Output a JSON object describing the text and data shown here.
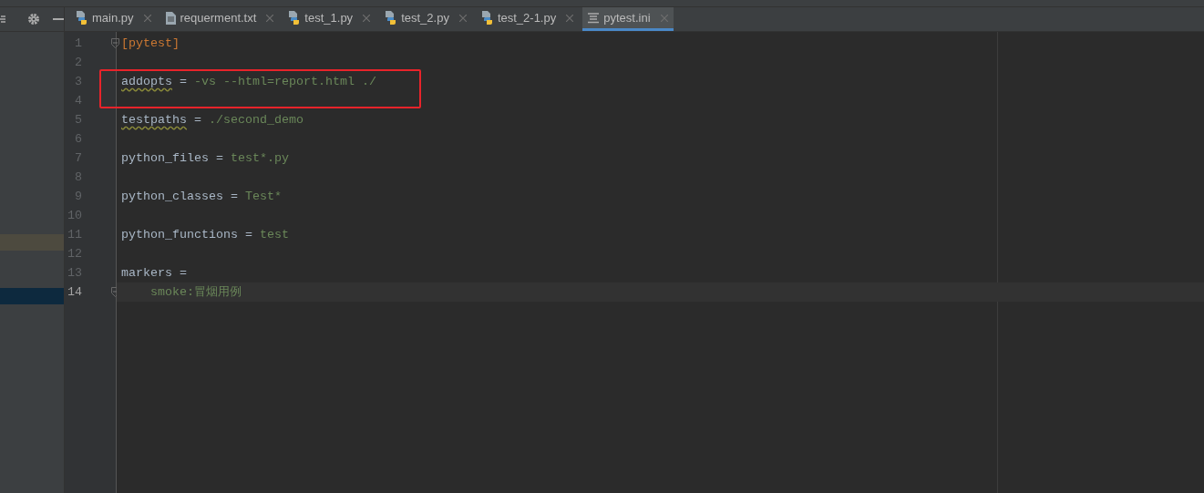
{
  "tabs": [
    {
      "label": "main.py",
      "kind": "python",
      "selected": false
    },
    {
      "label": "requerment.txt",
      "kind": "text",
      "selected": false
    },
    {
      "label": "test_1.py",
      "kind": "python",
      "selected": false
    },
    {
      "label": "test_2.py",
      "kind": "python",
      "selected": false
    },
    {
      "label": "test_2-1.py",
      "kind": "python",
      "selected": false
    },
    {
      "label": "pytest.ini",
      "kind": "ini",
      "selected": true
    }
  ],
  "editor": {
    "lines": [
      {
        "number": "1",
        "fold": true,
        "current": false,
        "boxed": false,
        "segments": [
          {
            "text": "[pytest]",
            "kind": "section",
            "warning": false
          }
        ]
      },
      {
        "number": "2",
        "fold": false,
        "current": false,
        "boxed": false
      },
      {
        "number": "3",
        "fold": false,
        "current": false,
        "boxed": true,
        "segments": [
          {
            "text": "addopts",
            "kind": "key",
            "warning": true
          },
          {
            "text": " = ",
            "kind": "op",
            "warning": false
          },
          {
            "text": "-vs --html=report.html ./",
            "kind": "value",
            "warning": false
          }
        ]
      },
      {
        "number": "4",
        "fold": false,
        "current": false,
        "boxed": false
      },
      {
        "number": "5",
        "fold": false,
        "current": false,
        "boxed": false,
        "segments": [
          {
            "text": "testpaths",
            "kind": "key",
            "warning": true
          },
          {
            "text": " = ",
            "kind": "op",
            "warning": false
          },
          {
            "text": "./second_demo",
            "kind": "value",
            "warning": false
          }
        ]
      },
      {
        "number": "6",
        "fold": false,
        "current": false,
        "boxed": false
      },
      {
        "number": "7",
        "fold": false,
        "current": false,
        "boxed": false,
        "segments": [
          {
            "text": "python_files",
            "kind": "key",
            "warning": false
          },
          {
            "text": " = ",
            "kind": "op",
            "warning": false
          },
          {
            "text": "test*.py",
            "kind": "value",
            "warning": false
          }
        ]
      },
      {
        "number": "8",
        "fold": false,
        "current": false,
        "boxed": false
      },
      {
        "number": "9",
        "fold": false,
        "current": false,
        "boxed": false,
        "segments": [
          {
            "text": "python_classes",
            "kind": "key",
            "warning": false
          },
          {
            "text": " = ",
            "kind": "op",
            "warning": false
          },
          {
            "text": "Test*",
            "kind": "value",
            "warning": false
          }
        ]
      },
      {
        "number": "10",
        "fold": false,
        "current": false,
        "boxed": false
      },
      {
        "number": "11",
        "fold": false,
        "current": false,
        "boxed": false,
        "segments": [
          {
            "text": "python_functions",
            "kind": "key",
            "warning": false
          },
          {
            "text": " = ",
            "kind": "op",
            "warning": false
          },
          {
            "text": "test",
            "kind": "value",
            "warning": false
          }
        ]
      },
      {
        "number": "12",
        "fold": false,
        "current": false,
        "boxed": false
      },
      {
        "number": "13",
        "fold": false,
        "current": false,
        "boxed": false,
        "segments": [
          {
            "text": "markers",
            "kind": "key",
            "warning": false
          },
          {
            "text": " =",
            "kind": "op",
            "warning": false
          }
        ]
      },
      {
        "number": "14",
        "fold": true,
        "current": true,
        "boxed": false,
        "segments": [
          {
            "text": "    smoke:冒烟用例",
            "kind": "value",
            "warning": false
          }
        ]
      }
    ]
  }
}
